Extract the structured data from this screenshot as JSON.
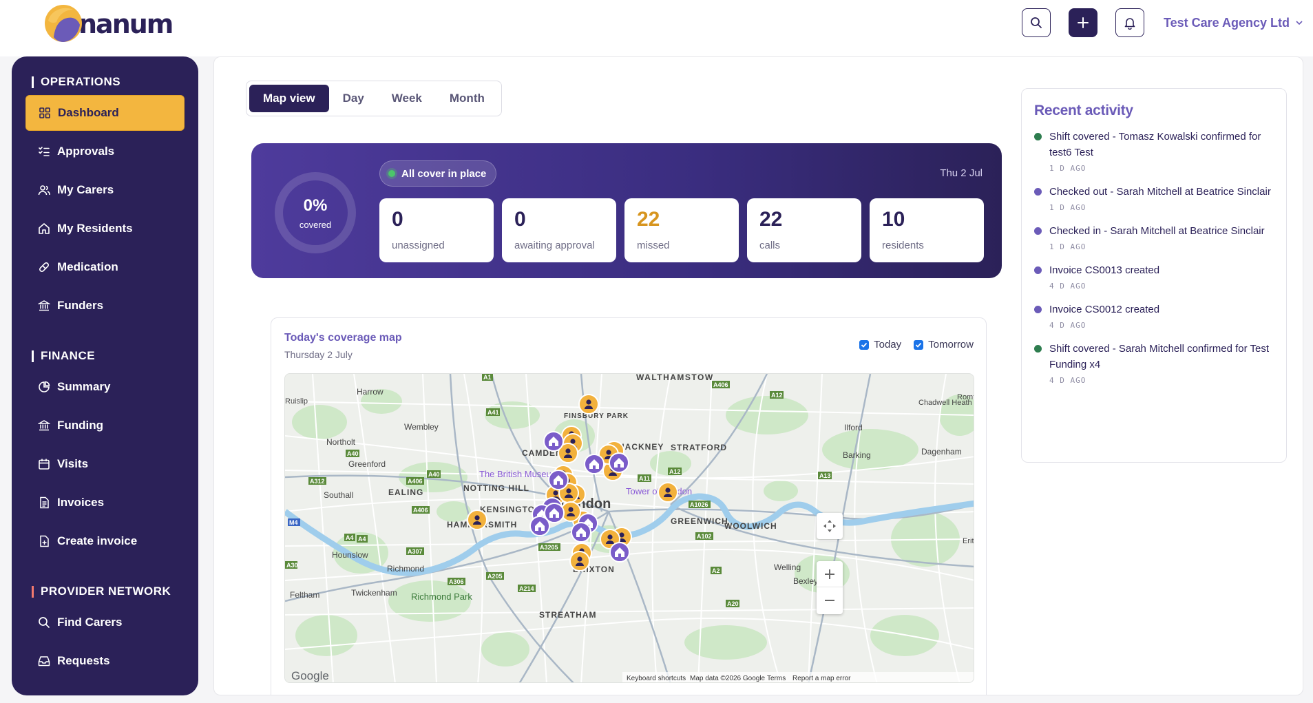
{
  "brand": {
    "logo_text": "nanum"
  },
  "header": {
    "agency": "Test Care Agency Ltd",
    "colors": {
      "primary": "#2b2158",
      "accent": "#f3b63f"
    }
  },
  "sidebar": {
    "sections": [
      {
        "title": "OPERATIONS",
        "items": [
          {
            "label": "Dashboard",
            "icon": "grid-icon",
            "active": true
          },
          {
            "label": "Approvals",
            "icon": "checklist-icon"
          },
          {
            "label": "My Carers",
            "icon": "users-icon"
          },
          {
            "label": "My Residents",
            "icon": "home-icon"
          },
          {
            "label": "Medication",
            "icon": "pill-icon"
          },
          {
            "label": "Funders",
            "icon": "bank-icon"
          }
        ]
      },
      {
        "title": "FINANCE",
        "items": [
          {
            "label": "Summary",
            "icon": "pie-icon"
          },
          {
            "label": "Funding",
            "icon": "bank-icon"
          },
          {
            "label": "Visits",
            "icon": "calendar-icon"
          },
          {
            "label": "Invoices",
            "icon": "document-icon"
          },
          {
            "label": "Create invoice",
            "icon": "document-plus-icon"
          }
        ]
      },
      {
        "title": "PROVIDER NETWORK",
        "items": [
          {
            "label": "Find Carers",
            "icon": "search-icon"
          },
          {
            "label": "Requests",
            "icon": "inbox-icon"
          }
        ]
      }
    ]
  },
  "tabs": [
    {
      "label": "Map view",
      "active": true
    },
    {
      "label": "Day"
    },
    {
      "label": "Week"
    },
    {
      "label": "Month"
    }
  ],
  "coverage": {
    "percent": "0%",
    "percent_label": "covered",
    "status": "All cover in place",
    "date": "Thu 2 Jul",
    "stats": [
      {
        "value": "0",
        "label": "unassigned"
      },
      {
        "value": "0",
        "label": "awaiting approval"
      },
      {
        "value": "22",
        "label": "missed",
        "warn": true
      },
      {
        "value": "22",
        "label": "calls"
      },
      {
        "value": "10",
        "label": "residents"
      }
    ]
  },
  "map": {
    "title": "Today's coverage map",
    "subtitle": "Thursday 2 July",
    "filters": [
      {
        "label": "Today",
        "checked": true
      },
      {
        "label": "Tomorrow",
        "checked": true
      }
    ],
    "place_labels": [
      "WALTHAMSTOW",
      "Harrow",
      "Chadwell Heath",
      "FINSBURY PARK",
      "Wembley",
      "Ilford",
      "Northolt",
      "CAMDEN",
      "HACKNEY",
      "STRATFORD",
      "Dagenham",
      "Greenford",
      "The British Museum",
      "Barking",
      "NOTTING HILL",
      "Southall",
      "EALING",
      "Tower of London",
      "KENSINGTON",
      "London",
      "HAMMERSMITH",
      "GREENWICH",
      "WOOLWICH",
      "Hounslow",
      "Richmond",
      "Welling",
      "Bexley",
      "Feltham",
      "Twickenham",
      "Richmond Park",
      "BRIXTON",
      "STREATHAM",
      "Romford",
      "Erith",
      "Ruislip"
    ],
    "road_labels": [
      "A1",
      "A406",
      "A12",
      "A41",
      "A40",
      "A312",
      "A406",
      "A40",
      "A11",
      "A12",
      "A13",
      "A4",
      "A406",
      "A1026",
      "A4",
      "A307",
      "A3205",
      "A102",
      "A30",
      "A306",
      "A205",
      "A214",
      "A2",
      "A20",
      "M4"
    ],
    "attribution": {
      "google": "Google",
      "shortcuts": "Keyboard shortcuts",
      "data": "Map data ©2026 Google",
      "terms": "Terms",
      "report": "Report a map error"
    },
    "markers_count": {
      "carers": 20,
      "residents": 10
    }
  },
  "recent": {
    "title": "Recent activity",
    "items": [
      {
        "text": "Shift covered - Tomasz Kowalski confirmed for test6 Test",
        "time": "1 D AGO",
        "color": "#2e7d4f"
      },
      {
        "text": "Checked out - Sarah Mitchell at Beatrice Sinclair",
        "time": "1 D AGO",
        "color": "#6b5bb8"
      },
      {
        "text": "Checked in - Sarah Mitchell at Beatrice Sinclair",
        "time": "1 D AGO",
        "color": "#6b5bb8"
      },
      {
        "text": "Invoice CS0013 created",
        "time": "4 D AGO",
        "color": "#6b5bb8"
      },
      {
        "text": "Invoice CS0012 created",
        "time": "4 D AGO",
        "color": "#6b5bb8"
      },
      {
        "text": "Shift covered - Sarah Mitchell confirmed for Test Funding x4",
        "time": "4 D AGO",
        "color": "#2e7d4f"
      }
    ]
  }
}
